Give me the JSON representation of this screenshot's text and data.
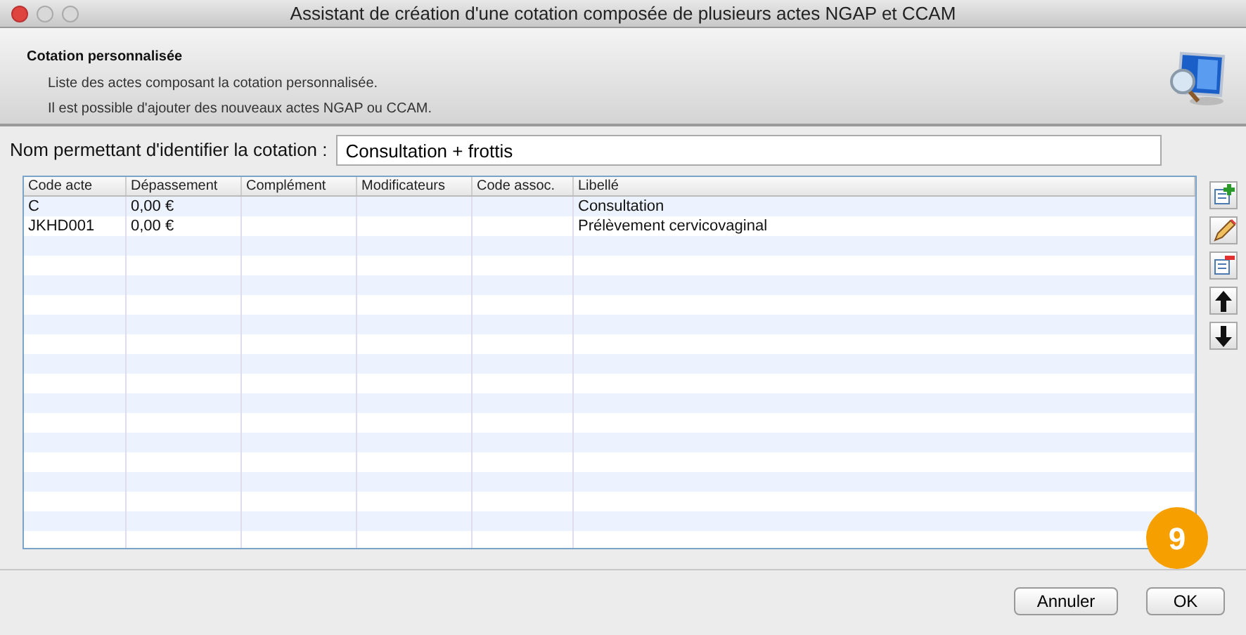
{
  "window": {
    "title": "Assistant de création d'une cotation composée de plusieurs actes NGAP et CCAM"
  },
  "header": {
    "title": "Cotation personnalisée",
    "lines": [
      "Liste des actes composant la cotation personnalisée.",
      "Il est possible d'ajouter des nouveaux actes NGAP ou CCAM."
    ]
  },
  "name_field": {
    "label": "Nom permettant d'identifier la cotation :",
    "value": "Consultation + frottis"
  },
  "table": {
    "columns": [
      "Code acte",
      "Dépassement",
      "Complément",
      "Modificateurs",
      "Code assoc.",
      "Libellé"
    ],
    "rows": [
      [
        "C",
        "0,00 €",
        "",
        "",
        "",
        "Consultation"
      ],
      [
        "JKHD001",
        "0,00 €",
        "",
        "",
        "",
        "Prélèvement cervicovaginal"
      ]
    ]
  },
  "side_tools": [
    {
      "kind": "add"
    },
    {
      "kind": "edit"
    },
    {
      "kind": "delete"
    },
    {
      "kind": "up"
    },
    {
      "kind": "down"
    }
  ],
  "callout": "9",
  "buttons": [
    "Annuler",
    "OK"
  ]
}
